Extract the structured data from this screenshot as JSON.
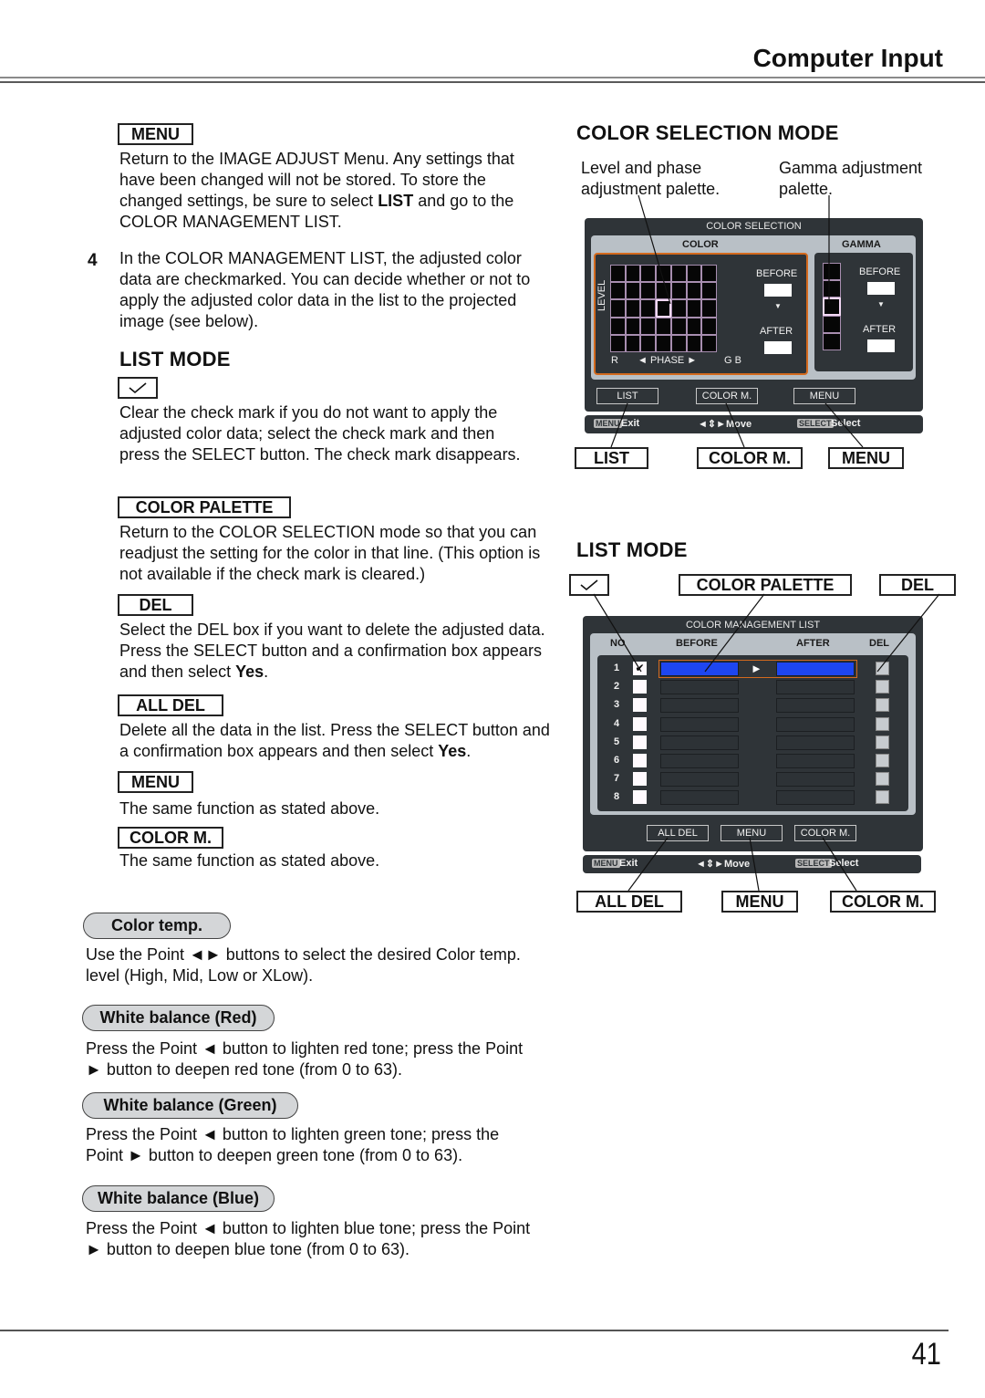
{
  "header": {
    "title": "Computer Input"
  },
  "footer": {
    "page_number": "41"
  },
  "left": {
    "menu_key": "MENU",
    "menu_desc_parts": [
      "Return to the IMAGE ADJUST Menu. Any settings that have been changed will not be stored. To store the changed settings, be sure to select ",
      "LIST",
      " and go to the COLOR MANAGEMENT LIST."
    ],
    "step4_number": "4",
    "step4_text": "In the COLOR MANAGEMENT LIST, the adjusted color data are checkmarked. You can decide whether or not to apply the adjusted color data in the list to the projected image (see below).",
    "list_mode_heading": "LIST MODE",
    "check_desc": "Clear the check mark if you do not want to apply the adjusted color data; select the check mark and then press the SELECT button. The check mark disappears.",
    "color_palette_key": "COLOR PALETTE",
    "color_palette_desc": "Return to the COLOR SELECTION mode so that you can readjust the setting for the color in that line. (This option is not available if the check mark is cleared.)",
    "del_key": "DEL",
    "del_desc_parts": [
      "Select the DEL box if you want to delete the adjusted data. Press the SELECT button and a confirmation box appears and then select ",
      "Yes",
      "."
    ],
    "all_del_key": "ALL DEL",
    "all_del_desc_parts": [
      "Delete all the data in the list. Press the SELECT button and a confirmation box appears and then select ",
      "Yes",
      "."
    ],
    "menu2_key": "MENU",
    "menu2_desc": "The same function as stated above.",
    "colorm_key": "COLOR M.",
    "colorm_desc": "The same function as stated above."
  },
  "settings": [
    {
      "label": "Color temp.",
      "desc": "Use the Point ◄► buttons to select the desired Color temp. level (High, Mid, Low or XLow)."
    },
    {
      "label": "White balance (Red)",
      "desc": "Press the Point ◄ button to lighten red tone; press the Point ► button to deepen red tone (from 0 to 63)."
    },
    {
      "label": "White balance (Green)",
      "desc": "Press the Point ◄ button to lighten green tone; press the Point ► button to deepen green tone (from 0 to 63)."
    },
    {
      "label": "White balance (Blue)",
      "desc": "Press the Point ◄ button to lighten blue tone; press the Point ► button to deepen blue tone (from 0 to 63)."
    }
  ],
  "right": {
    "color_selection_heading": "COLOR SELECTION MODE",
    "callout_level": "Level and phase adjustment palette.",
    "callout_gamma": "Gamma adjustment palette.",
    "osd1": {
      "title": "COLOR SELECTION",
      "color_label": "COLOR",
      "gamma_label": "GAMMA",
      "level_label": "LEVEL",
      "phase_left": "R",
      "phase_label": "◄ PHASE ►",
      "phase_right": "G B",
      "before": "BEFORE",
      "after": "AFTER",
      "arrow_down": "▼",
      "buttons": [
        "LIST",
        "COLOR M.",
        "MENU"
      ],
      "nav": {
        "menu_tag": "MENU",
        "exit": "Exit",
        "move": "◄⇕►Move",
        "select_tag": "SELECT",
        "select": "Select"
      },
      "grid": {
        "cols": 7,
        "rows": 5,
        "selected_col": 4,
        "selected_row": 3
      },
      "gamma_grid": {
        "rows": 5,
        "selected_row": 3
      }
    },
    "osd1_keys": [
      "LIST",
      "COLOR M.",
      "MENU"
    ],
    "list_mode_heading": "LIST MODE",
    "list_keys_top": [
      "✓",
      "COLOR PALETTE",
      "DEL"
    ],
    "osd2": {
      "title": "COLOR MANAGEMENT LIST",
      "col_no": "NO",
      "col_before": "BEFORE",
      "col_after": "AFTER",
      "col_del": "DEL",
      "rows": [
        {
          "no": "1",
          "checked": true,
          "has_data": true
        },
        {
          "no": "2",
          "checked": false,
          "has_data": false
        },
        {
          "no": "3",
          "checked": false,
          "has_data": false
        },
        {
          "no": "4",
          "checked": false,
          "has_data": false
        },
        {
          "no": "5",
          "checked": false,
          "has_data": false
        },
        {
          "no": "6",
          "checked": false,
          "has_data": false
        },
        {
          "no": "7",
          "checked": false,
          "has_data": false
        },
        {
          "no": "8",
          "checked": false,
          "has_data": false
        }
      ],
      "data_color": "#1e46f0",
      "arrow": "►",
      "checkmark": "✔",
      "buttons": [
        "ALL DEL",
        "MENU",
        "COLOR M."
      ],
      "nav": {
        "menu_tag": "MENU",
        "exit": "Exit",
        "move": "◄⇕►Move",
        "select_tag": "SELECT",
        "select": "Select"
      }
    },
    "list_keys_bottom": [
      "ALL DEL",
      "MENU",
      "COLOR M."
    ]
  }
}
